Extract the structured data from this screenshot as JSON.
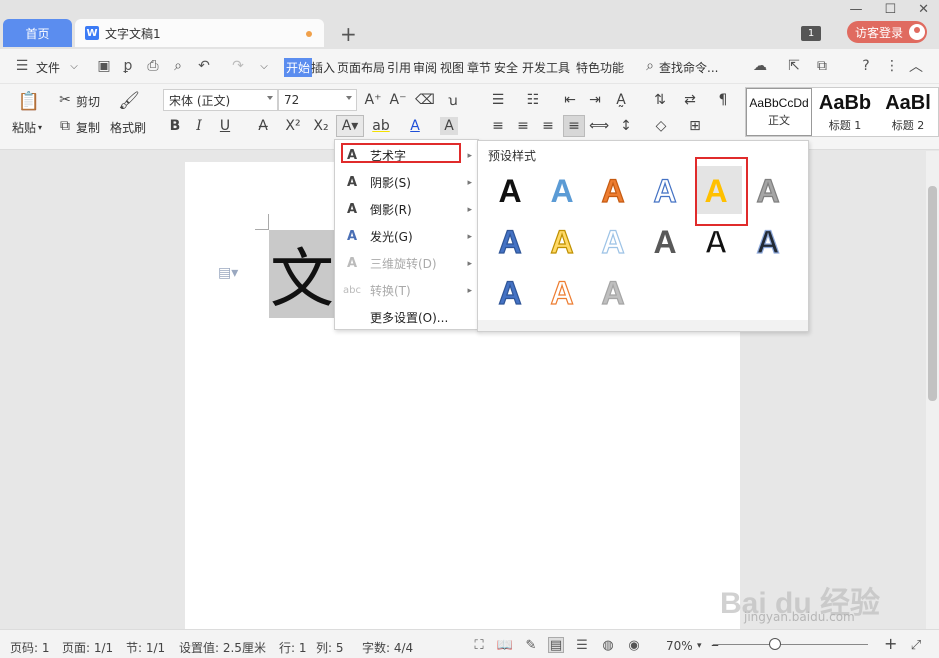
{
  "titlebar": {
    "home_tab": "首页",
    "doc_tab": "文字文稿1",
    "doc_icon": "W",
    "new_tab": "+",
    "tab_count": "1",
    "login": "访客登录",
    "minimize": "—",
    "maximize": "☐",
    "close": "✕"
  },
  "menubar": {
    "file": "文件",
    "tabs": [
      "开始",
      "插入",
      "页面布局",
      "引用",
      "审阅",
      "视图",
      "章节",
      "安全",
      "开发工具",
      "特色功能"
    ],
    "search": "查找命令..."
  },
  "ribbon": {
    "paste": "粘贴",
    "cut": "剪切",
    "copy": "复制",
    "format_painter": "格式刷",
    "font_name": "宋体 (正文)",
    "font_size": "72",
    "bold": "B",
    "italic": "I",
    "underline": "U",
    "styles": [
      {
        "preview": "AaBbCcDd",
        "label": "正文"
      },
      {
        "preview": "AaBb",
        "label": "标题 1"
      },
      {
        "preview": "AaBl",
        "label": "标题 2"
      }
    ]
  },
  "document": {
    "selected_text": "文"
  },
  "dropdown": {
    "items": [
      {
        "label": "艺术字",
        "icon": "A",
        "disabled": false
      },
      {
        "label": "阴影(S)",
        "icon": "A",
        "disabled": false
      },
      {
        "label": "倒影(R)",
        "icon": "A",
        "disabled": false
      },
      {
        "label": "发光(G)",
        "icon": "A",
        "disabled": false
      },
      {
        "label": "三维旋转(D)",
        "icon": "A",
        "disabled": true
      },
      {
        "label": "转换(T)",
        "icon": "abc",
        "disabled": true
      },
      {
        "label": "更多设置(O)...",
        "icon": "",
        "disabled": false
      }
    ]
  },
  "presets": {
    "title": "预设样式",
    "glyph": "A",
    "colors": [
      "#111111",
      "#5b9bd5",
      "#ed7d31",
      "#ffffff",
      "#ffc000",
      "#a5a5a5",
      "#4472c4",
      "#ffd966",
      "#ffffff",
      "#595959",
      "#111111",
      "#222a35",
      "#4472c4",
      "#ffffff",
      "#bfbfbf"
    ],
    "strokes": [
      "none",
      "none",
      "#c55a11",
      "#4472c4",
      "none",
      "#7f7f7f",
      "#2f5597",
      "#bf9000",
      "#9dc3e6",
      "none",
      "#ffffff",
      "#8faadc",
      "#2f5597",
      "#ed7d31",
      "#a5a5a5"
    ]
  },
  "statusbar": {
    "page_num": "页码: 1",
    "pages": "页面: 1/1",
    "section": "节: 1/1",
    "setting": "设置值: 2.5厘米",
    "row": "行: 1",
    "col": "列: 5",
    "words": "字数: 4/4",
    "zoom": "70%",
    "zoom_fraction": 0.4
  },
  "watermark": {
    "brand": "Bai du 经验",
    "url": "jingyan.baidu.com"
  }
}
